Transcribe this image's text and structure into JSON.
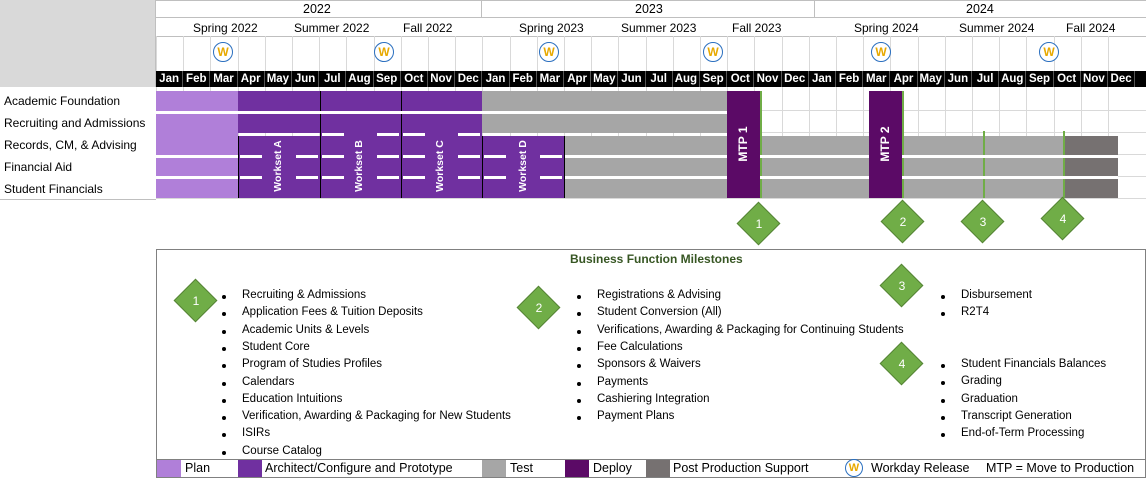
{
  "years": [
    "2022",
    "2023",
    "2024"
  ],
  "terms": [
    "Spring 2022",
    "Summer 2022",
    "Fall 2022",
    "Spring 2023",
    "Summer 2023",
    "Fall 2023",
    "Spring 2024",
    "Summer 2024",
    "Fall 2024"
  ],
  "months": [
    "Jan",
    "Feb",
    "Mar",
    "Apr",
    "May",
    "Jun",
    "Jul",
    "Aug",
    "Sep",
    "Oct",
    "Nov",
    "Dec",
    "Jan",
    "Feb",
    "Mar",
    "Apr",
    "May",
    "Jun",
    "Jul",
    "Aug",
    "Sep",
    "Oct",
    "Nov",
    "Dec",
    "Jan",
    "Feb",
    "Mar",
    "Apr",
    "May",
    "Jun",
    "Jul",
    "Aug",
    "Sep",
    "Oct",
    "Nov",
    "Dec"
  ],
  "workday_symbol": "W",
  "rows": [
    "Academic Foundation",
    "Recruiting and Admissions",
    "Records, CM, & Advising",
    "Financial Aid",
    "Student Financials"
  ],
  "worksets": [
    "Workset A",
    "Workset B",
    "Workset C",
    "Workset D"
  ],
  "mtp_labels": [
    "MTP 1",
    "MTP 2"
  ],
  "milestone_numbers": [
    "1",
    "2",
    "3",
    "4"
  ],
  "milestones_title": "Business Function Milestones",
  "milestone_groups": [
    {
      "number": "1",
      "items": [
        "Recruiting & Admissions",
        "Application Fees & Tuition Deposits",
        "Academic Units & Levels",
        "Student Core",
        "Program of Studies Profiles",
        "Calendars",
        "Education Intuitions",
        "Verification, Awarding & Packaging for New Students",
        "ISIRs",
        "Course Catalog"
      ]
    },
    {
      "number": "2",
      "items": [
        "Registrations & Advising",
        "Student Conversion (All)",
        "Verifications, Awarding & Packaging for Continuing Students",
        "Fee Calculations",
        "Sponsors & Waivers",
        "Payments",
        "Cashiering Integration",
        "Payment Plans"
      ]
    },
    {
      "number": "3",
      "items": [
        "Disbursement",
        "R2T4"
      ]
    },
    {
      "number": "4",
      "items": [
        "Student Financials Balances",
        "Grading",
        "Graduation",
        "Transcript Generation",
        "End-of-Term Processing"
      ]
    }
  ],
  "legend": {
    "plan": "Plan",
    "architect": "Architect/Configure and Prototype",
    "test": "Test",
    "deploy": "Deploy",
    "post": "Post Production Support",
    "workday": "Workday Release",
    "mtp": "MTP = Move to Production"
  },
  "colors": {
    "plan": "#b07fd9",
    "architect": "#7030a0",
    "test": "#a6a6a6",
    "deploy": "#5b0a66",
    "post": "#767171",
    "milestone": "#70ad47",
    "title_green": "#375623"
  }
}
